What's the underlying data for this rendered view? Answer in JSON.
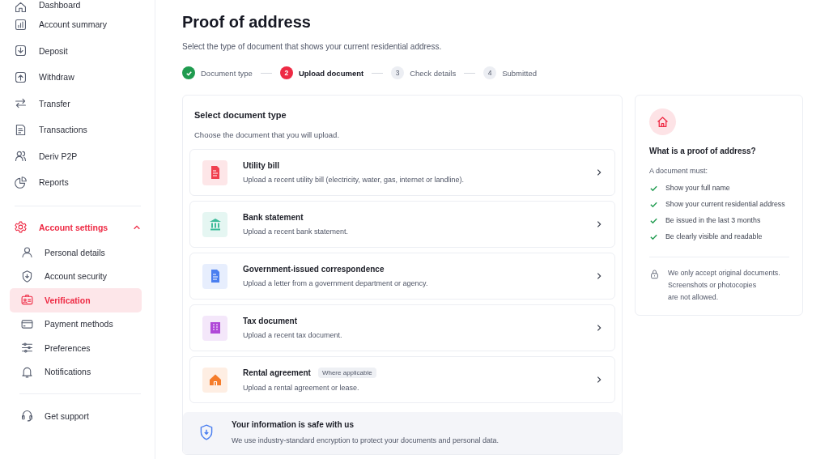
{
  "sidebar": {
    "items": [
      {
        "label": "Dashboard"
      },
      {
        "label": "Account summary"
      },
      {
        "label": "Deposit"
      },
      {
        "label": "Withdraw"
      },
      {
        "label": "Transfer"
      },
      {
        "label": "Transactions"
      },
      {
        "label": "Deriv P2P"
      },
      {
        "label": "Reports"
      }
    ],
    "settings": {
      "label": "Account settings",
      "expanded": true,
      "children": [
        {
          "label": "Personal details",
          "selected": false
        },
        {
          "label": "Account security",
          "selected": false
        },
        {
          "label": "Verification",
          "selected": true
        },
        {
          "label": "Payment methods",
          "selected": false
        },
        {
          "label": "Preferences",
          "selected": false
        },
        {
          "label": "Notifications",
          "selected": false
        }
      ]
    },
    "support": {
      "label": "Get support"
    }
  },
  "page": {
    "title": "Proof of address",
    "subtitle": "Select the type of document that shows your current residential address.",
    "steps": [
      {
        "label": "Document type",
        "completed": true,
        "selected": false
      },
      {
        "number": "2",
        "label": "Upload document",
        "completed": false,
        "selected": true
      },
      {
        "number": "3",
        "label": "Check details",
        "completed": false,
        "selected": false
      },
      {
        "number": "4",
        "label": "Submitted",
        "completed": false,
        "selected": false
      }
    ]
  },
  "select_card": {
    "title": "Select document type",
    "subtitle": "Choose the document that you will upload.",
    "options": [
      {
        "kind": "document",
        "color": "#f0404f",
        "title": "Utility bill",
        "description": "Upload a recent utility bill (electricity, water, gas, internet or landline)."
      },
      {
        "kind": "bank",
        "color": "#3dbb9a",
        "title": "Bank statement",
        "description": "Upload a recent bank statement."
      },
      {
        "kind": "document",
        "color": "#4a7ef0",
        "title": "Government-issued correspondence",
        "description": "Upload a letter from a government department or agency."
      },
      {
        "kind": "building",
        "color": "#b048d8",
        "title": "Tax document",
        "description": "Upload a recent tax document."
      },
      {
        "kind": "house",
        "color": "#f57c2a",
        "title": "Rental agreement",
        "badge": "Where applicable",
        "description": "Upload a rental agreement or lease."
      }
    ],
    "notice": {
      "title": "Your information is safe with us",
      "text": "We use industry-standard encryption to protect your documents and personal data."
    }
  },
  "info_card": {
    "title": "What is a proof of address?",
    "intro": "A document must:",
    "requirements": [
      "Show your full name",
      "Show your current residential address",
      "Be issued in the last 3 months",
      "Be clearly visible and readable"
    ],
    "note": [
      "We only accept original documents.",
      "Screenshots or photocopies",
      "are not allowed."
    ]
  }
}
